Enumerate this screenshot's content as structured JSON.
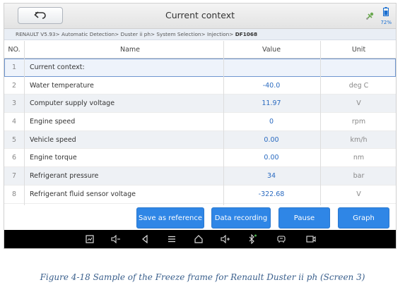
{
  "header": {
    "title": "Current context",
    "battery_pct": "72%"
  },
  "breadcrumb": {
    "path": "RENAULT V5.93> Automatic Detection> Duster ii ph> System Selection> Injection> ",
    "last": "DF1068"
  },
  "table": {
    "headers": {
      "no": "NO.",
      "name": "Name",
      "value": "Value",
      "unit": "Unit"
    },
    "rows": [
      {
        "no": "1",
        "name": "Current context:",
        "value": "",
        "unit": ""
      },
      {
        "no": "2",
        "name": "Water temperature",
        "value": "-40.0",
        "unit": "deg C"
      },
      {
        "no": "3",
        "name": "Computer supply voltage",
        "value": "11.97",
        "unit": "V"
      },
      {
        "no": "4",
        "name": "Engine speed",
        "value": "0",
        "unit": "rpm"
      },
      {
        "no": "5",
        "name": "Vehicle speed",
        "value": "0.00",
        "unit": "km/h"
      },
      {
        "no": "6",
        "name": "Engine torque",
        "value": "0.00",
        "unit": "nm"
      },
      {
        "no": "7",
        "name": "Refrigerant pressure",
        "value": "34",
        "unit": "bar"
      },
      {
        "no": "8",
        "name": "Refrigerant fluid sensor voltage",
        "value": "-322.68",
        "unit": "V"
      }
    ]
  },
  "buttons": {
    "save_reference": "Save as reference",
    "data_recording": "Data recording",
    "pause": "Pause",
    "graph": "Graph"
  },
  "colors": {
    "accent": "#2f86e6",
    "value_text": "#2b6bc0",
    "selected_border": "#6f96cf"
  },
  "caption": "Figure 4-18 Sample of the Freeze frame for Renault Duster ii ph (Screen 3)"
}
